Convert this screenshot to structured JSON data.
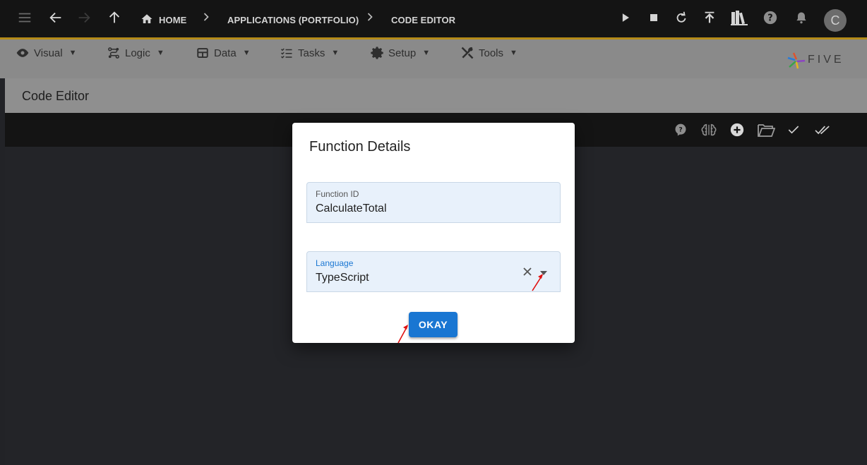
{
  "breadcrumbs": {
    "home": "HOME",
    "applications": "APPLICATIONS (PORTFOLIO)",
    "current": "CODE EDITOR"
  },
  "user": {
    "avatar_initial": "C"
  },
  "menu": {
    "items": [
      {
        "label": "Visual",
        "icon": "eye-icon"
      },
      {
        "label": "Logic",
        "icon": "logic-icon"
      },
      {
        "label": "Data",
        "icon": "table-icon"
      },
      {
        "label": "Tasks",
        "icon": "tasks-icon"
      },
      {
        "label": "Setup",
        "icon": "gear-icon"
      },
      {
        "label": "Tools",
        "icon": "tools-icon"
      }
    ],
    "caret": "▼"
  },
  "brand": {
    "name": "FIVE"
  },
  "page": {
    "title": "Code Editor"
  },
  "dialog": {
    "title": "Function Details",
    "function_id": {
      "label": "Function ID",
      "value": "CalculateTotal"
    },
    "language": {
      "label": "Language",
      "value": "TypeScript"
    },
    "okay_label": "OKAY"
  },
  "colors": {
    "topbar": "#141414",
    "accent_line": "#b48b19",
    "primary": "#1976d2",
    "annotation_arrow": "#e01010"
  }
}
